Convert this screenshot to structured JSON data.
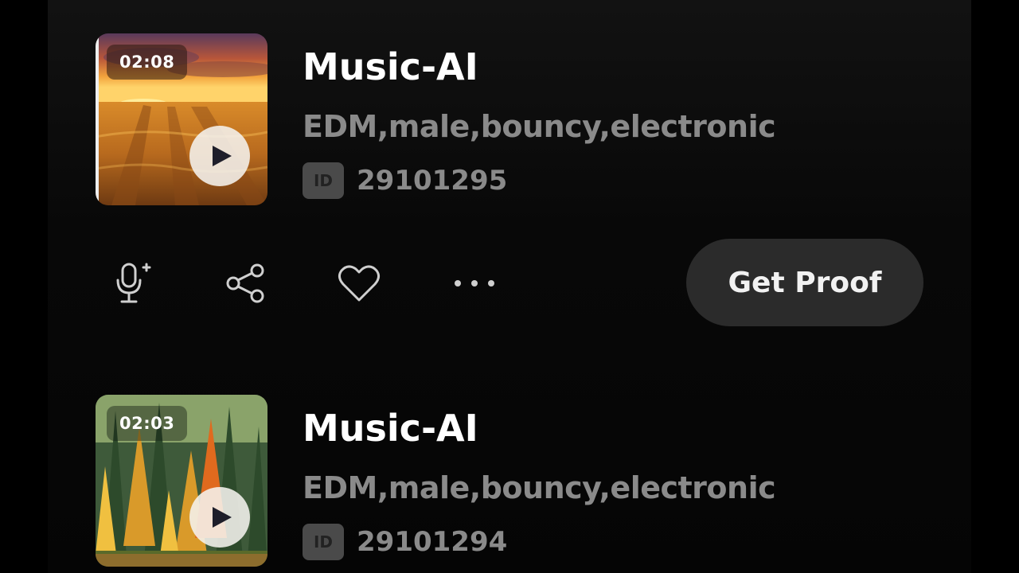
{
  "tracks": [
    {
      "duration": "02:08",
      "title": "Music-AI",
      "tags": "EDM,male,bouncy,electronic",
      "id_label": "ID",
      "id_value": "29101295",
      "cover_icon": "wheat-field-sunset-artwork"
    },
    {
      "duration": "02:03",
      "title": "Music-AI",
      "tags": "EDM,male,bouncy,electronic",
      "id_label": "ID",
      "id_value": "29101294",
      "cover_icon": "autumn-forest-artwork"
    }
  ],
  "actions": {
    "mic_icon": "microphone-sparkle-icon",
    "share_icon": "share-icon",
    "like_icon": "heart-icon",
    "more_icon": "more-dots-icon",
    "get_proof_label": "Get Proof"
  },
  "colors": {
    "background": "#000000",
    "title": "#ffffff",
    "secondary_text": "#8a8a8a",
    "button_bg": "#2b2b2b"
  }
}
